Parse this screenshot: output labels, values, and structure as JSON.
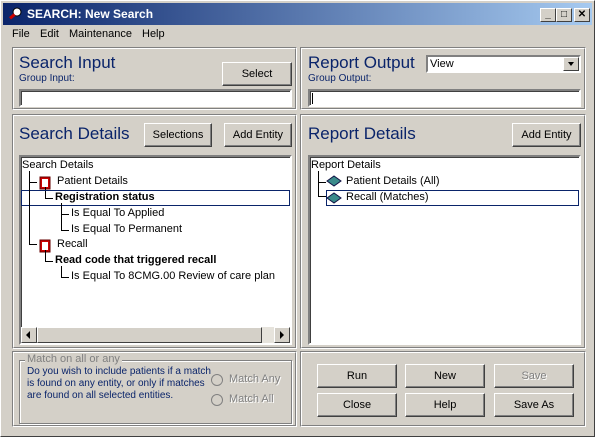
{
  "window": {
    "title": "SEARCH: New Search"
  },
  "menu": [
    "File",
    "Edit",
    "Maintenance",
    "Help"
  ],
  "search_input": {
    "heading": "Search Input",
    "group_label": "Group Input:",
    "select_label": "Select",
    "value": ""
  },
  "report_output": {
    "heading": "Report Output",
    "group_label": "Group Output:",
    "view_value": "View",
    "value": ""
  },
  "search_details": {
    "heading": "Search Details",
    "selections_label": "Selections",
    "add_entity_label": "Add Entity",
    "tree": [
      "Search Details",
      "Patient Details",
      "Registration status",
      "Is Equal To Applied",
      "Is Equal To Permanent",
      "Recall",
      "Read code that triggered recall",
      "Is Equal To 8CMG.00 Review of care plan"
    ]
  },
  "report_details": {
    "heading": "Report Details",
    "add_entity_label": "Add Entity",
    "tree": [
      "Report Details",
      "Patient Details (All)",
      "Recall (Matches)"
    ]
  },
  "match_group": {
    "legend": "Match on all or any",
    "description": "Do you wish to include patients if a match is found on any entity, or only if matches are found on all selected entities.",
    "match_any": "Match Any",
    "match_all": "Match All"
  },
  "actions": {
    "run": "Run",
    "new": "New",
    "save": "Save",
    "close": "Close",
    "help": "Help",
    "save_as": "Save As"
  },
  "colors": {
    "heading": "#0a246a",
    "titlebar_start": "#0a246a",
    "titlebar_end": "#a6caf0",
    "face": "#d4d0c8"
  }
}
